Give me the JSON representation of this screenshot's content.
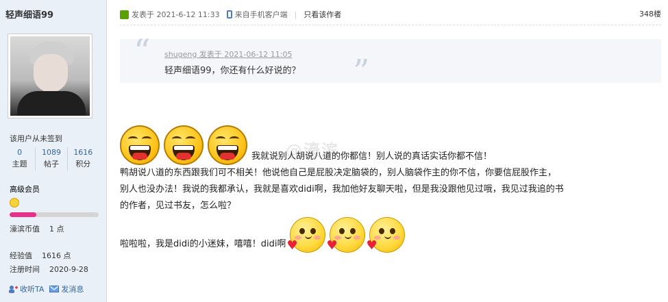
{
  "user": {
    "name": "轻声细语99",
    "checkin": "该用户从未签到",
    "stats": [
      {
        "value": "0",
        "label": "主题"
      },
      {
        "value": "1089",
        "label": "帖子"
      },
      {
        "value": "1616",
        "label": "积分"
      }
    ],
    "level": "高级会员",
    "level_progress": 0.3,
    "coins_label": "濠滨币值",
    "coins_value": "1 点",
    "exp_label": "经验值",
    "exp_value": "1616 点",
    "reg_label": "注册时间",
    "reg_value": "2020-9-28",
    "follow_label": "收听TA",
    "message_label": "发消息"
  },
  "post": {
    "posted": "发表于  2021-6-12 11:33",
    "client": "来自手机客户端",
    "sep": "|",
    "only_author": "只看该作者",
    "floor": "348楼",
    "quote_meta": "shugeng 发表于 2021-06-12 11:05",
    "quote_text": "轻声细语99，你还有什么好说的？",
    "watermark": "@濠滨",
    "line1": "我就说别人胡说八道的你都信！别人说的真话实话你都不信！",
    "line2": "鸭胡说八道的东西跟我们可不相关！他说他自己是屁股决定脑袋的，别人脑袋作主的你不信，你要信屁股作主，",
    "line3": "别人也没办法！我说的我都承认，我就是喜欢didi啊，我加他好友聊天啦，但是我没跟他见过哦，我见过我追的书",
    "line4": "的作者，见过书友，怎么啦？",
    "line5": "啦啦啦，我是didi的小迷妹，嘻嘻！didi啊"
  }
}
